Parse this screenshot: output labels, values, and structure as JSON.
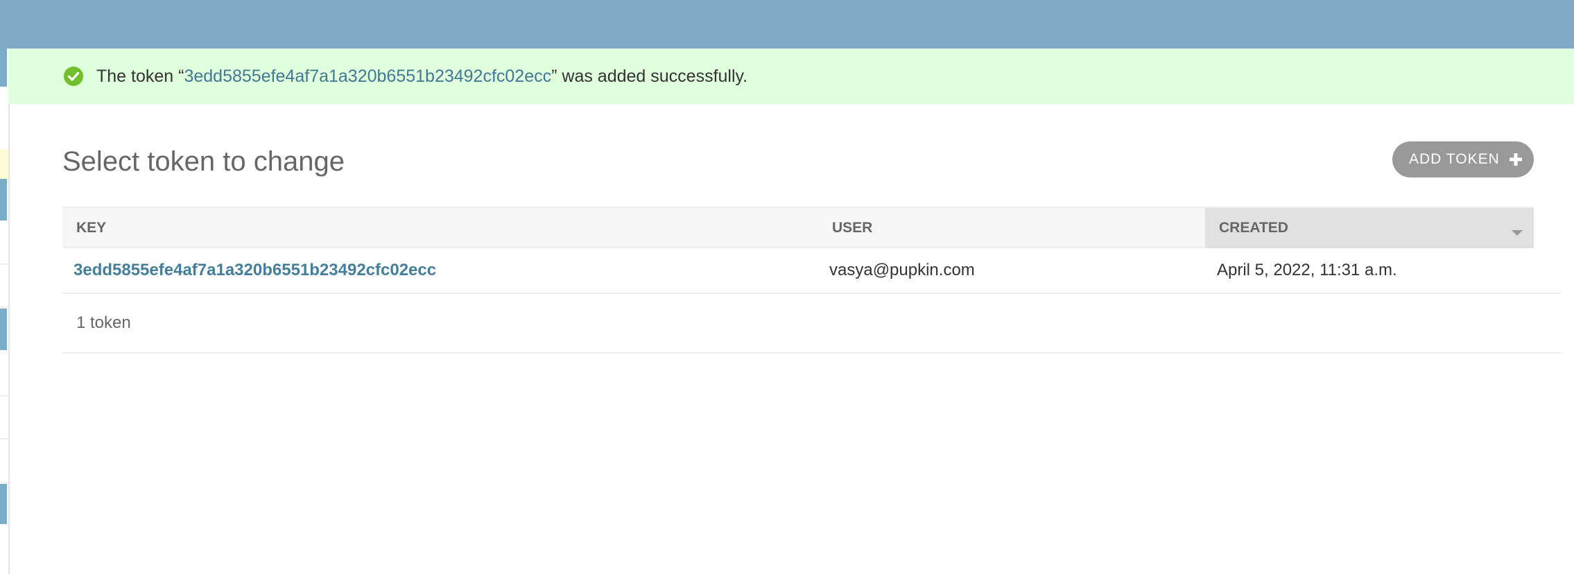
{
  "message": {
    "prefix": "The token “",
    "token_link": "3edd5855efe4af7a1a320b6551b23492cfc02ecc",
    "suffix": "” was added successfully.",
    "icon": "check-circle-icon",
    "color": "#70bf2b"
  },
  "page": {
    "title": "Select token to change",
    "add_button_label": "ADD TOKEN",
    "add_button_icon": "plus-icon"
  },
  "table": {
    "columns": [
      "KEY",
      "USER",
      "CREATED"
    ],
    "sorted_column": "CREATED",
    "rows": [
      {
        "key": "3edd5855efe4af7a1a320b6551b23492cfc02ecc",
        "user": "vasya@pupkin.com",
        "created": "April 5, 2022, 11:31 a.m."
      }
    ]
  },
  "paginator": {
    "count_text": "1 token"
  },
  "colors": {
    "header": "#81aac6",
    "message_bg": "#dfffdd",
    "link": "#447e9b",
    "button": "#999999"
  }
}
